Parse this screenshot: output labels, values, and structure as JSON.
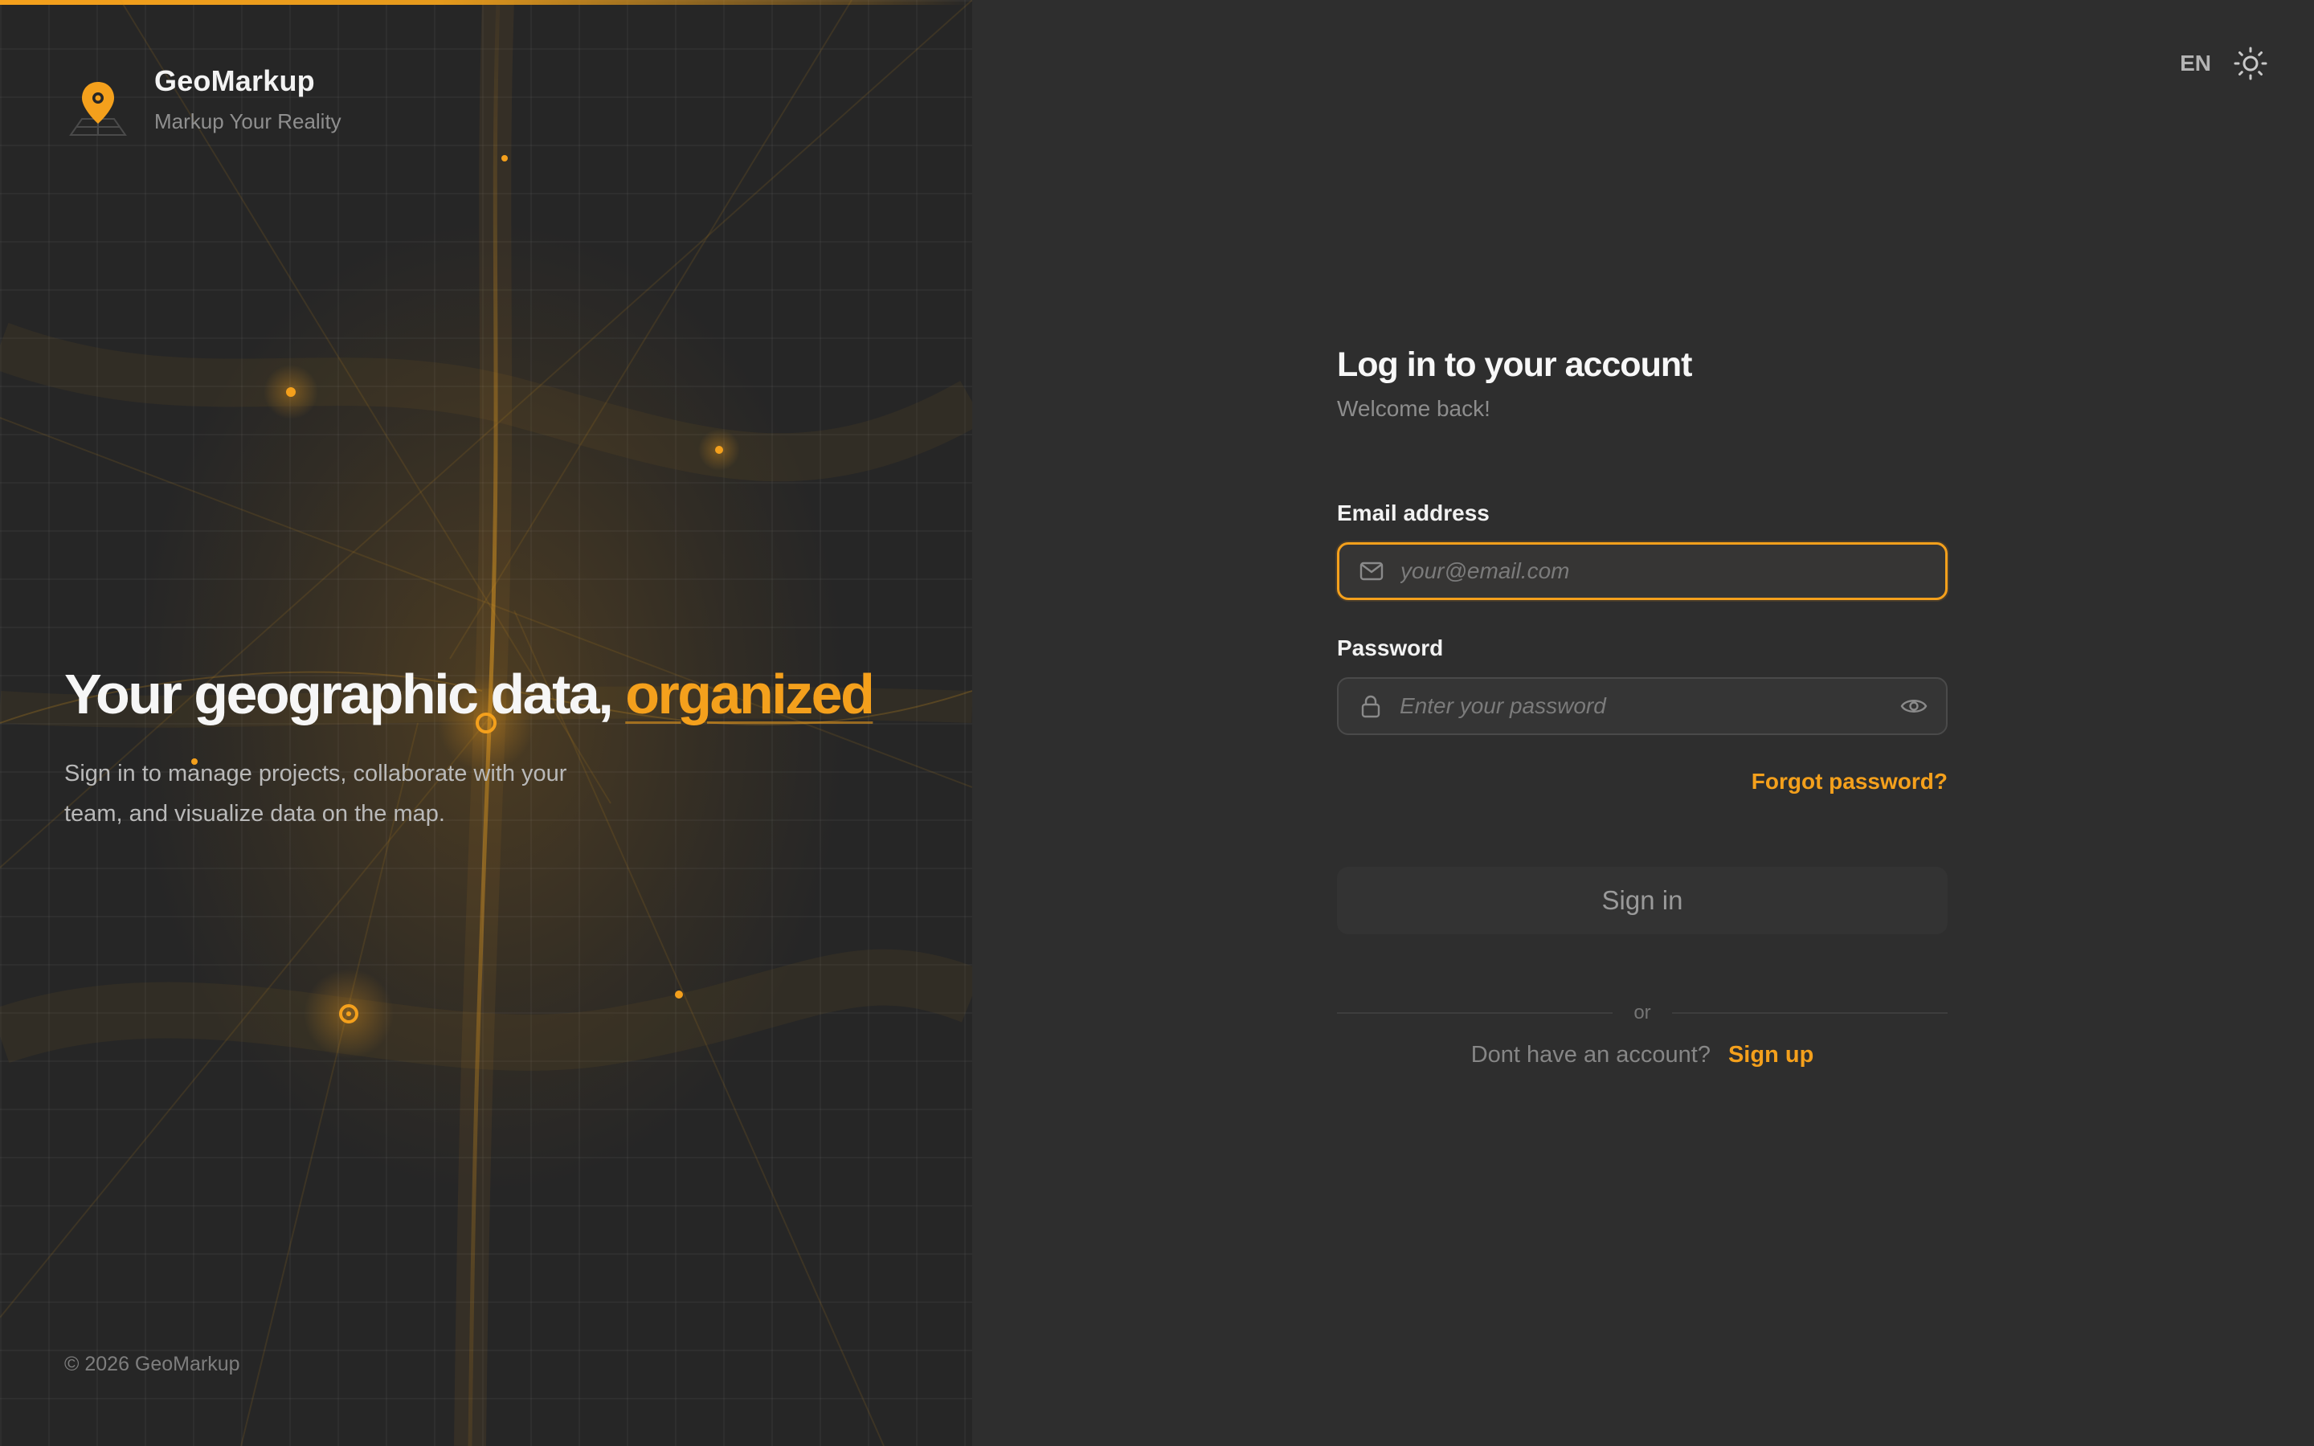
{
  "brand": {
    "name": "GeoMarkup",
    "tagline": "Markup Your Reality"
  },
  "hero": {
    "headline": "Your geographic data,",
    "headline_accent": "organized",
    "description": "Sign in to manage projects, collaborate with your team, and visualize data on the map."
  },
  "footer": {
    "copyright": "© 2026 GeoMarkup"
  },
  "topbar": {
    "language": "EN",
    "theme_icon": "sun-icon"
  },
  "form": {
    "title": "Log in to your account",
    "subtitle": "Welcome back!",
    "email_label": "Email address",
    "email_placeholder": "your@email.com",
    "email_value": "",
    "password_label": "Password",
    "password_placeholder": "Enter your password",
    "password_value": "",
    "forgot_link": "Forgot password?",
    "submit_label": "Sign in",
    "divider_text": "or",
    "signup_question": "Dont have an account?",
    "signup_link": "Sign up"
  },
  "icons": {
    "logo": "map-pin-icon",
    "email": "mail-icon",
    "password": "lock-icon",
    "toggle_visibility": "eye-icon"
  },
  "colors": {
    "accent": "#f4a01c",
    "left_bg": "#262626",
    "right_bg": "#2e2e2e",
    "input_bg": "#353535",
    "button_bg": "#333333"
  }
}
